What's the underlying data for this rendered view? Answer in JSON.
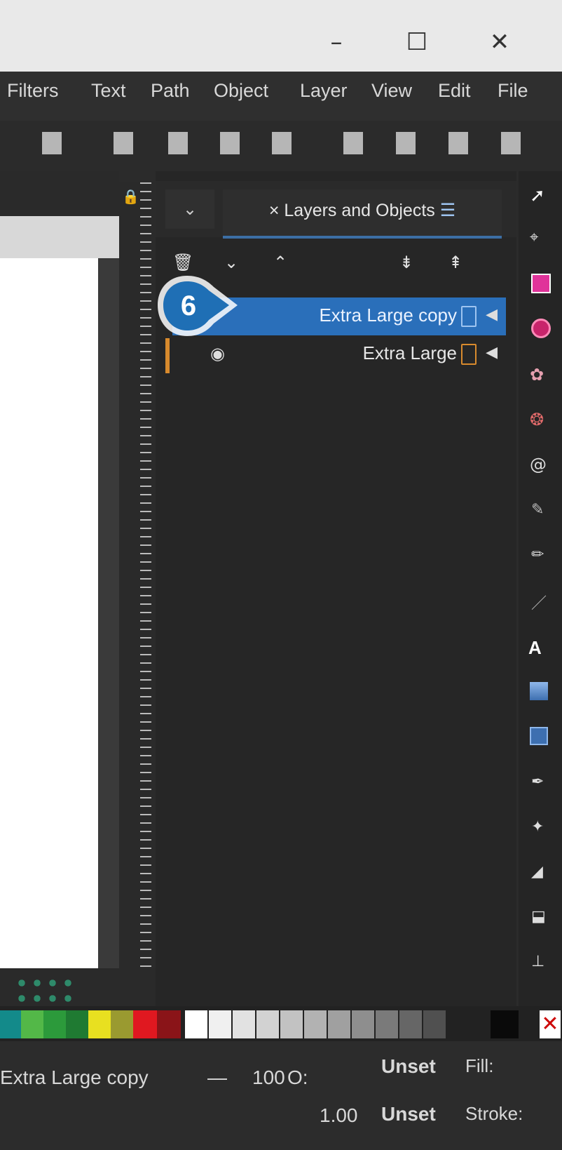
{
  "window": {
    "minimize_icon": "minimize-icon",
    "maximize_icon": "maximize-icon",
    "close_icon": "close-icon"
  },
  "menu": {
    "items": [
      "Filters",
      "Text",
      "Path",
      "Object",
      "Layer",
      "View",
      "Edit",
      "File"
    ]
  },
  "panel": {
    "tab_label": "Layers and Objects",
    "rows": [
      {
        "label": "Extra Large copy",
        "selected": true
      },
      {
        "label": "Extra Large",
        "selected": false
      }
    ]
  },
  "callout": {
    "number": "6",
    "color": "#1f6fb5"
  },
  "colors": {
    "selection": "#2a6fba",
    "accent_tab": "#3c6ea4",
    "layer_orange": "#d88a2d"
  },
  "status": {
    "object_name": "Extra Large copy",
    "opacity_label": "100",
    "opacity_suffix": "O:",
    "stroke_width": "1.00",
    "fill_value": "Unset",
    "stroke_value": "Unset",
    "fill_label": "Fill:",
    "stroke_label": "Stroke:"
  }
}
